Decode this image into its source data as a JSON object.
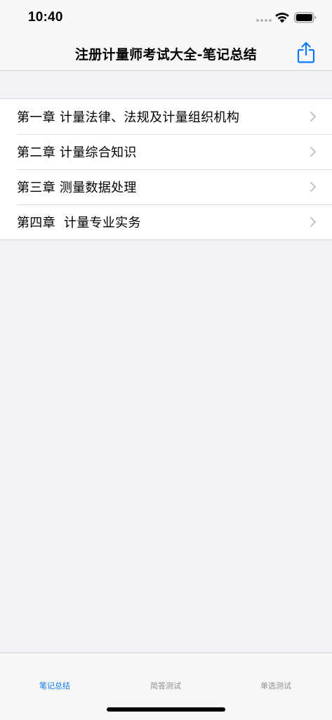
{
  "status_bar": {
    "time": "10:40",
    "icons": [
      "signal-dots-icon",
      "wifi-icon",
      "battery-icon"
    ]
  },
  "nav": {
    "title": "注册计量师考试大全-笔记总结",
    "share_icon": "share-icon",
    "accent_color": "#0a7aff"
  },
  "chapters": [
    {
      "label": "第一章 计量法律、法规及计量组织机构"
    },
    {
      "label": "第二章 计量综合知识"
    },
    {
      "label": "第三章 测量数据处理"
    },
    {
      "label": "第四章  计量专业实务"
    }
  ],
  "tabs": [
    {
      "label": "笔记总结",
      "active": true
    },
    {
      "label": "简答测试",
      "active": false
    },
    {
      "label": "单选测试",
      "active": false
    }
  ]
}
